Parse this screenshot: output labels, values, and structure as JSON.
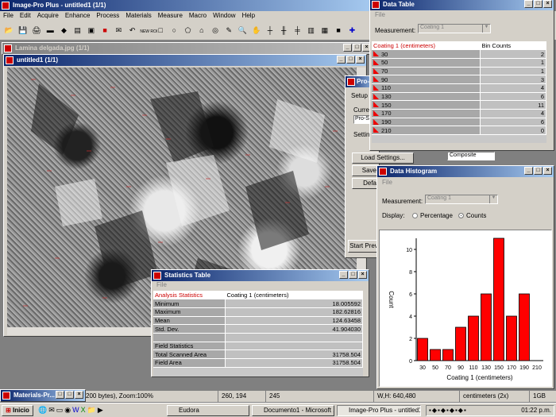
{
  "app": {
    "title": "Image-Pro Plus - untitled1 (1/1)",
    "menu": [
      "File",
      "Edit",
      "Acquire",
      "Enhance",
      "Process",
      "Materials",
      "Measure",
      "Macro",
      "Window",
      "Help"
    ],
    "toolbar_roi": "NEW ROI"
  },
  "image_window": {
    "title": "Lamina delgada.jpg (1/1)"
  },
  "untitled_window": {
    "title": "untitled1 (1/1)"
  },
  "procomp": {
    "title": "Pro-C",
    "setup_tab": "Setup",
    "current_label": "Curren",
    "current_value": "Pro-S",
    "settings_label": "Setting",
    "load_button": "Load Settings...",
    "save_button": "Save",
    "default_button": "Defa",
    "start_button": "Start Prev",
    "composite_value": "Composite"
  },
  "data_table": {
    "title": "Data Table",
    "menu_file": "File",
    "measurement_label": "Measurement:",
    "measurement_value": "Coating 1",
    "col1": "Coating 1 (centimeters)",
    "col2": "Bin Counts",
    "rows": [
      {
        "bin": "30",
        "count": "2"
      },
      {
        "bin": "50",
        "count": "1"
      },
      {
        "bin": "70",
        "count": "1"
      },
      {
        "bin": "90",
        "count": "3"
      },
      {
        "bin": "110",
        "count": "4"
      },
      {
        "bin": "130",
        "count": "6"
      },
      {
        "bin": "150",
        "count": "11"
      },
      {
        "bin": "170",
        "count": "4"
      },
      {
        "bin": "190",
        "count": "6"
      },
      {
        "bin": "210",
        "count": "0"
      }
    ]
  },
  "histogram": {
    "title": "Data Histogram",
    "menu_file": "File",
    "measurement_label": "Measurement:",
    "measurement_value": "Coating 1",
    "display_label": "Display:",
    "percentage_label": "Percentage",
    "counts_label": "Counts",
    "selected_display": "Counts",
    "ylabel": "Count",
    "xlabel": "Coating 1 (centimeters)"
  },
  "chart_data": {
    "type": "bar",
    "categories": [
      "30",
      "50",
      "70",
      "90",
      "110",
      "130",
      "150",
      "170",
      "190",
      "210"
    ],
    "values": [
      2,
      1,
      1,
      3,
      4,
      6,
      11,
      4,
      6,
      0
    ],
    "xlabel": "Coating 1 (centimeters)",
    "ylabel": "Count",
    "ylim": [
      0,
      11
    ],
    "yticks": [
      "0",
      "2",
      "4",
      "6",
      "8",
      "10"
    ],
    "bar_color": "#ff0000",
    "grid": false
  },
  "stats": {
    "title": "Statistics Table",
    "menu_file": "File",
    "col1": "Analysis Statistics",
    "col2": "Coating 1 (centimeters)",
    "rows": [
      {
        "label": "Minimum",
        "value": "18.005592"
      },
      {
        "label": "Maximum",
        "value": "182.62816"
      },
      {
        "label": "Mean",
        "value": "124.63458"
      },
      {
        "label": "Std. Dev.",
        "value": "41.904030"
      },
      {
        "label": "",
        "value": ""
      },
      {
        "label": "Field Statistics",
        "value": ""
      },
      {
        "label": "Total Scanned Area",
        "value": "31758.504"
      },
      {
        "label": "Field Area",
        "value": "31758.504"
      }
    ]
  },
  "minimized": {
    "title": "Materials-Pr..."
  },
  "statusbar": {
    "info": "200 bytes), Zoom:100%",
    "coords": "260, 194",
    "value": "245",
    "wh": "W,H: 640,480",
    "units": "centimeters (2x)",
    "memory": "1GB"
  },
  "taskbar": {
    "start": "Inicio",
    "items": [
      "Eudora",
      "Documento1 - Microsoft ...",
      "Image-Pro Plus - untitled1..."
    ],
    "clock": "01:22 p.m."
  }
}
